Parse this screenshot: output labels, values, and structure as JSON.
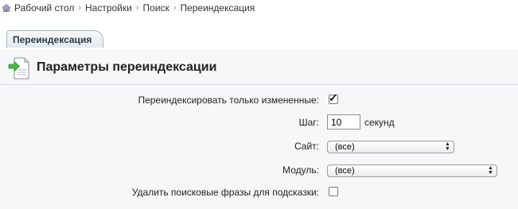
{
  "breadcrumb": {
    "items": [
      "Рабочий стол",
      "Настройки",
      "Поиск",
      "Переиндексация"
    ],
    "separator": "›"
  },
  "tabs": [
    {
      "label": "Переиндексация",
      "active": true
    }
  ],
  "panel": {
    "title": "Параметры переиндексации"
  },
  "form": {
    "only_changed": {
      "label": "Переиндексировать только измененные:",
      "checked": true
    },
    "step": {
      "label": "Шаг:",
      "value": "10",
      "unit": "секунд"
    },
    "site": {
      "label": "Сайт:",
      "selected": "(все)"
    },
    "module": {
      "label": "Модуль:",
      "selected": "(все)"
    },
    "delete_phrases": {
      "label": "Удалить поисковые фразы для подсказки:",
      "checked": false
    }
  },
  "colors": {
    "accent": "#2b3a4a",
    "panel_bg": "#f5f7f9",
    "tab_border": "#a9b6c3"
  },
  "icons": {
    "home": "home-icon",
    "panel": "reindex-document-icon"
  }
}
